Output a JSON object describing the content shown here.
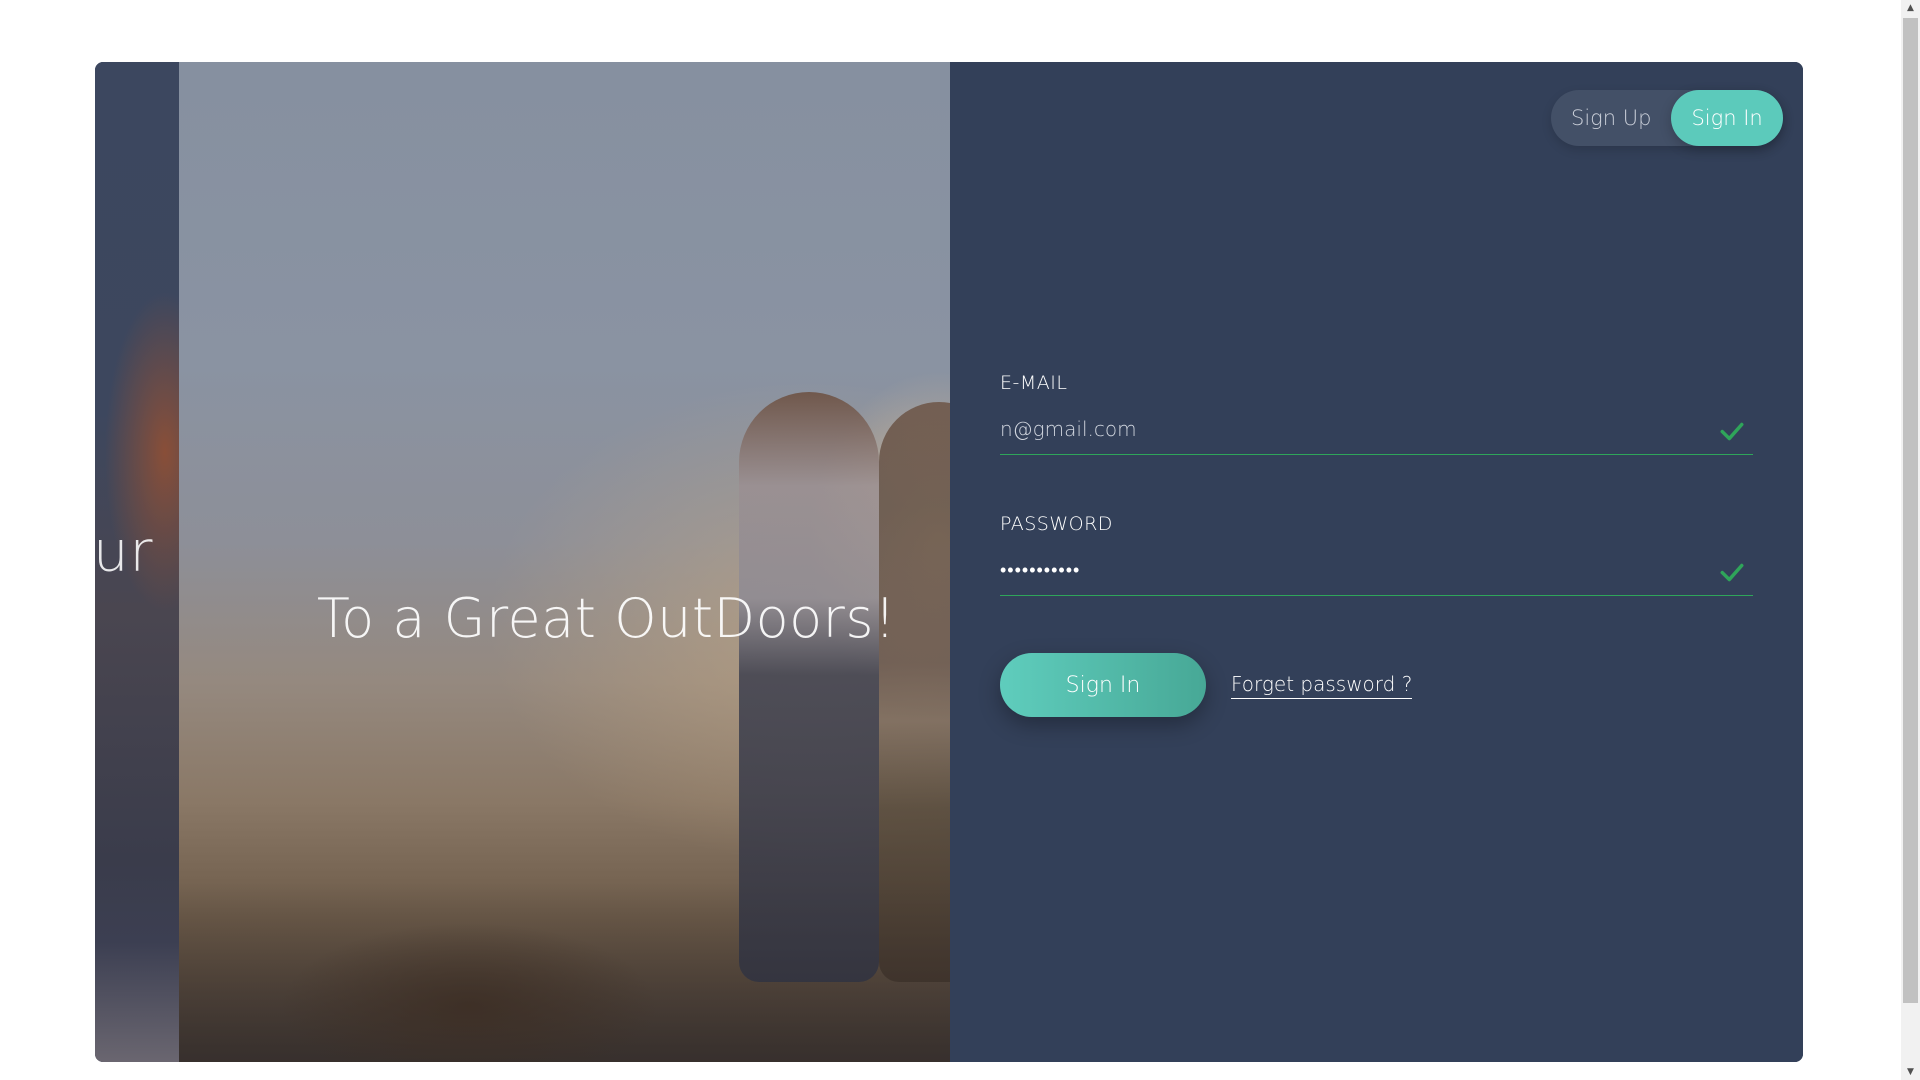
{
  "hero": {
    "title": "To a Great OutDoors!",
    "partial_back_text": "ur"
  },
  "toggle": {
    "sign_up_label": "Sign Up",
    "sign_in_label": "Sign In",
    "active": "Sign In"
  },
  "form": {
    "email_label": "E-MAIL",
    "email_value": "n@gmail.com",
    "password_label": "PASSWORD",
    "password_value": "•••••••••••",
    "submit_label": "Sign In",
    "forget_label": "Forget password ?"
  },
  "colors": {
    "accent": "#5ccabb",
    "panel": "#334059",
    "valid": "#2fa55a"
  },
  "icons": {
    "valid": "check-icon",
    "scroll_up": "chevron-up-icon",
    "scroll_down": "chevron-down-icon"
  }
}
